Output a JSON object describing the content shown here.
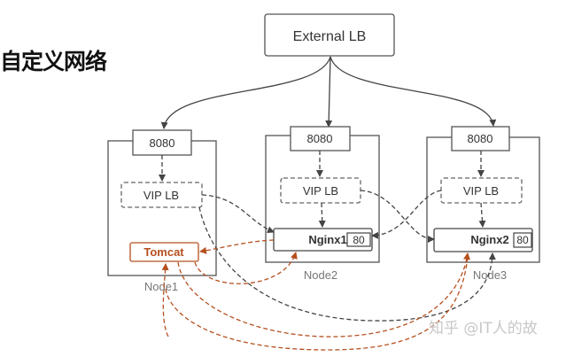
{
  "title": "自定义网络",
  "external_lb": "External LB",
  "nodes": [
    {
      "label": "Node1",
      "port": "8080",
      "vip": "VIP LB",
      "service": "Tomcat"
    },
    {
      "label": "Node2",
      "port": "8080",
      "vip": "VIP LB",
      "service": "Nginx1",
      "service_port": "80"
    },
    {
      "label": "Node3",
      "port": "8080",
      "vip": "VIP LB",
      "service": "Nginx2",
      "service_port": "80"
    }
  ],
  "watermark": "知乎 @IT人的故",
  "colors": {
    "line": "#444444",
    "tomcat": "#b5501e"
  }
}
